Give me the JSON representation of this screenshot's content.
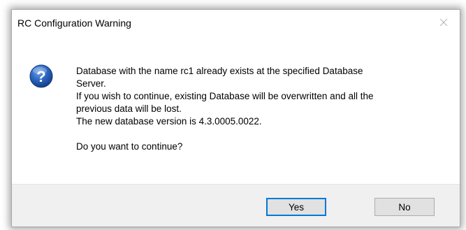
{
  "dialog": {
    "title": "RC Configuration Warning",
    "close_icon": "close-icon",
    "message_icon": "question-icon",
    "message_lines": [
      "Database with the name rc1 already exists at the specified Database",
      "Server.",
      "If you wish to continue, existing Database will be overwritten and all the",
      "previous data will be lost.",
      "The new database version is 4.3.0005.0022."
    ],
    "question": "Do you want to continue?",
    "buttons": {
      "yes_label": "Yes",
      "no_label": "No"
    }
  },
  "colors": {
    "accent": "#0078d7",
    "footer_bg": "#f0f0f0",
    "button_bg": "#e1e1e1",
    "icon_blue": "#1e5aa8"
  }
}
